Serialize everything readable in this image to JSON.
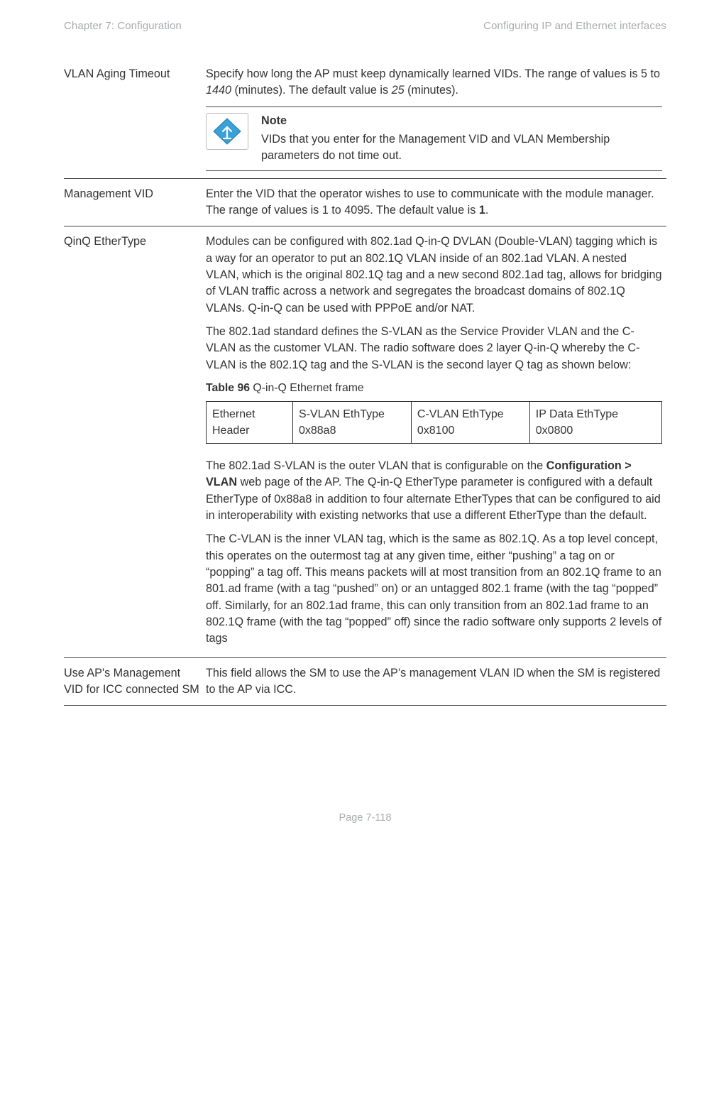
{
  "header": {
    "left": "Chapter 7:  Configuration",
    "right": "Configuring IP and Ethernet interfaces"
  },
  "rows": {
    "vlan_aging": {
      "label": "VLAN Aging Timeout",
      "p1a": "Specify how long the AP must keep dynamically learned VIDs. The range of values is 5 to ",
      "p1i1": "1440",
      "p1b": " (minutes). The default value is ",
      "p1i2": "25",
      "p1c": " (minutes).",
      "note_title": "Note",
      "note_body": "VIDs that you enter for the Management VID and VLAN Membership parameters do not time out."
    },
    "mgmt_vid": {
      "label": "Management VID",
      "p1a": "Enter the VID that the operator wishes to use to communicate with the module manager. The range of values is 1 to 4095. The default value is ",
      "p1b_bold": "1",
      "p1c": "."
    },
    "qinq": {
      "label": "QinQ EtherType",
      "p1": "Modules can be configured with 802.1ad Q-in-Q DVLAN (Double-VLAN) tagging which is a way for an operator to put an 802.1Q VLAN inside of an 802.1ad VLAN. A nested VLAN, which is the original 802.1Q tag and a new second 802.1ad tag, allows for bridging of VLAN traffic across a network and segregates the broadcast domains of 802.1Q VLANs. Q-in-Q can be used with PPPoE and/or NAT.",
      "p2": "The 802.1ad standard defines the S-VLAN as the Service Provider VLAN and the C-VLAN as the customer VLAN. The radio software does 2 layer Q-in-Q whereby the C-VLAN is the 802.1Q tag and the S-VLAN is the second layer Q tag as shown below:",
      "table_caption_bold": "Table 96",
      "table_caption_rest": " Q-in-Q Ethernet frame",
      "frame": {
        "c1": "Ethernet Header",
        "c2": "S-VLAN EthType 0x88a8",
        "c3": "C-VLAN EthType 0x8100",
        "c4": "IP Data EthType 0x0800"
      },
      "p3a": "The 802.1ad S-VLAN is the outer VLAN that is configurable on the ",
      "p3bold": "Configuration > VLAN",
      "p3b": " web page of the AP. The Q-in-Q EtherType parameter is configured with a default EtherType of 0x88a8 in addition to four alternate EtherTypes that can be configured to aid in interoperability with existing networks that use a different EtherType than the default.",
      "p4": "The C-VLAN is the inner VLAN tag, which is the same as 802.1Q. As a top level concept, this operates on the outermost tag at any given time, either “pushing” a tag on or “popping” a tag off. This means packets will at most transition from an 802.1Q frame to an 801.ad frame (with a tag “pushed” on) or an untagged 802.1 frame (with the tag “popped” off. Similarly, for an 802.1ad frame, this can only transition from an 802.1ad frame to an 802.1Q frame (with the tag “popped” off) since the radio software only supports 2 levels of tags"
    },
    "use_ap": {
      "label": "Use AP's Management VID for ICC connected SM",
      "body": "This field allows the SM to use the AP’s management VLAN ID when the SM is registered to the AP via ICC."
    }
  },
  "footer": "Page 7-118"
}
